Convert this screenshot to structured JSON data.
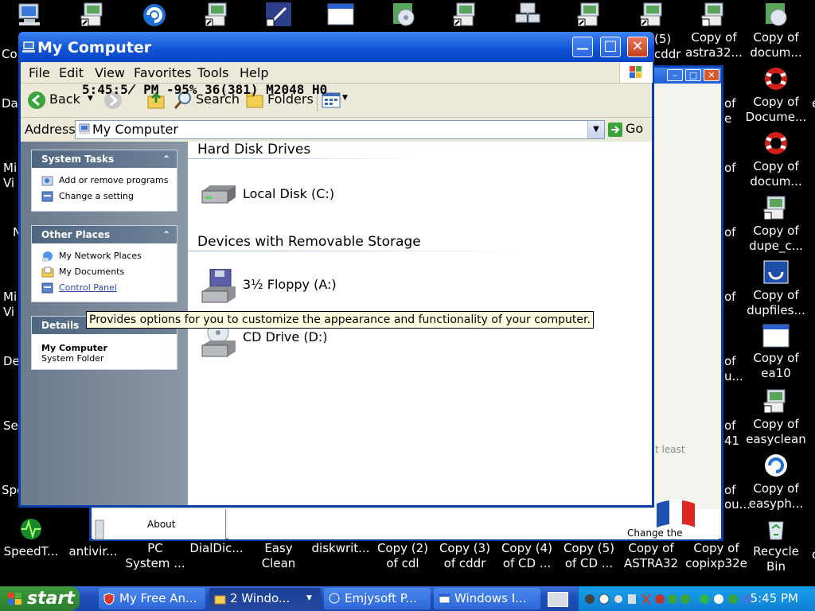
{
  "desktop": {
    "top_icons": [
      {
        "name": "computer-icon",
        "label": ""
      },
      {
        "name": "shortcut-icon",
        "label": ""
      },
      {
        "name": "refresh-app-icon",
        "label": ""
      },
      {
        "name": "shortcut-icon",
        "label": ""
      },
      {
        "name": "pen-app-icon",
        "label": ""
      },
      {
        "name": "window-icon",
        "label": ""
      },
      {
        "name": "cd-app-icon",
        "label": ""
      },
      {
        "name": "shortcut-icon",
        "label": ""
      },
      {
        "name": "network-app-icon",
        "label": ""
      },
      {
        "name": "shortcut-icon",
        "label": ""
      },
      {
        "name": "shortcut-icon",
        "label": ""
      },
      {
        "name": "shortcut-icon",
        "label": ""
      },
      {
        "name": "cd-app-icon",
        "label": ""
      }
    ],
    "right_column": [
      {
        "name": "shortcut-icon",
        "label": "Copy of\nastra32..."
      },
      {
        "name": "cd-app-icon",
        "label": "Copy of\ndocum..."
      },
      {
        "name": "lifebuoy-icon",
        "label": "Copy of\nDocume..."
      },
      {
        "name": "lifebuoy-icon",
        "label": "Copy of\ndocum..."
      },
      {
        "name": "shortcut-icon",
        "label": "Copy of\ndupe_c..."
      },
      {
        "name": "app-icon",
        "label": "Copy of\ndupfiles..."
      },
      {
        "name": "window-icon",
        "label": "Copy of\nea10"
      },
      {
        "name": "shortcut-icon",
        "label": "Copy of\neasyclean"
      },
      {
        "name": "refresh-app-icon",
        "label": "Copy of\neasyph..."
      }
    ],
    "bottom_row": [
      {
        "name": "speedtest-icon",
        "label": "SpeedT..."
      },
      {
        "name": "antivirus-icon",
        "label": "antivir..."
      },
      {
        "name": "pc-icon",
        "label": "PC\nSystem ..."
      },
      {
        "name": "dialer-icon",
        "label": "DialDic..."
      },
      {
        "name": "cleaner-icon",
        "label": "Easy\nClean"
      },
      {
        "name": "disk-icon",
        "label": "diskwrit..."
      },
      {
        "name": "file-icon",
        "label": "Copy (2)\nof cdl"
      },
      {
        "name": "file-icon",
        "label": "Copy (3)\nof cddr"
      },
      {
        "name": "file-icon",
        "label": "Copy (4)\nof CD ..."
      },
      {
        "name": "file-icon",
        "label": "Copy (5)\nof CD ..."
      },
      {
        "name": "file-icon",
        "label": "Copy of\nASTRA32"
      },
      {
        "name": "file-icon",
        "label": "Copy of\ncopixp32e"
      },
      {
        "name": "recycle-bin-icon",
        "label": "Recycle\nBin"
      }
    ],
    "fragments": {
      "co": "Co",
      "da": "Da",
      "mi1": "Mi\nVi",
      "n1": "N",
      "mi2": "Mi\nVi",
      "de": "De",
      "se": "Se",
      "sp": "Spe",
      "top_5": "(5)\ncddr",
      "of_1": "of",
      "e_1": "e",
      "of_2": "of",
      "of_3": "of",
      "of_4": "of\nu...",
      "of_5": "of\nou...",
      "of_6": "of\n41",
      "of_7": "of",
      "e_r": "e",
      "right_1": "o"
    }
  },
  "background_window": {
    "behind_text": "t least",
    "about_label": "About",
    "language_label": "Change the language"
  },
  "window": {
    "title": "My Computer",
    "menu": [
      "File",
      "Edit",
      "View",
      "Favorites",
      "Tools",
      "Help"
    ],
    "toolbar": {
      "back": "Back",
      "search": "Search",
      "folders": "Folders"
    },
    "address_label": "Address",
    "address_value": "My Computer",
    "go_label": "Go",
    "overlay_text": "5:45:5̸ PM -95% 36(381) M2048 H0",
    "left": {
      "system_tasks": {
        "header": "System Tasks",
        "items": [
          "Add or remove programs",
          "Change a setting"
        ]
      },
      "other_places": {
        "header": "Other Places",
        "items": [
          "My Network Places",
          "My Documents",
          "Control Panel"
        ]
      },
      "details": {
        "header": "Details",
        "name": "My Computer",
        "type": "System Folder"
      }
    },
    "content": {
      "group1": "Hard Disk Drives",
      "group2": "Devices with Removable Storage",
      "drives": [
        "Local Disk (C:)",
        "3½ Floppy (A:)",
        "CD Drive (D:)"
      ]
    },
    "tooltip": "Provides options for you to customize the appearance and functionality of your computer."
  },
  "taskbar": {
    "start": "start",
    "tasks": [
      "My Free An...",
      "2 Windo...",
      "Emjysoft P...",
      "Windows I..."
    ],
    "clock": "5:45 PM"
  }
}
